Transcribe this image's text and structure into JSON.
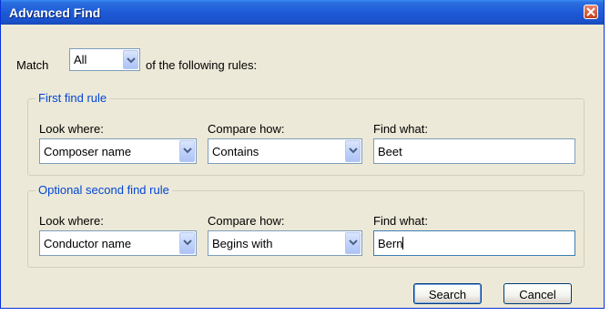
{
  "window": {
    "title": "Advanced Find"
  },
  "match": {
    "prefix": "Match",
    "selected": "All",
    "suffix": "of the following rules:"
  },
  "rules": [
    {
      "legend": "First find rule",
      "look_where_label": "Look where:",
      "look_where_value": "Composer name",
      "compare_how_label": "Compare how:",
      "compare_how_value": "Contains",
      "find_what_label": "Find what:",
      "find_what_value": "Beet"
    },
    {
      "legend": "Optional second find rule",
      "look_where_label": "Look where:",
      "look_where_value": "Conductor name",
      "compare_how_label": "Compare how:",
      "compare_how_value": "Begins with",
      "find_what_label": "Find what:",
      "find_what_value": "Bern"
    }
  ],
  "buttons": {
    "search": "Search",
    "cancel": "Cancel"
  },
  "icons": {
    "close": "close-icon",
    "dropdown": "chevron-down-icon"
  },
  "colors": {
    "titlebar": "#1e5ad6",
    "legend": "#0046d5",
    "dialog_bg": "#ece9d8"
  }
}
